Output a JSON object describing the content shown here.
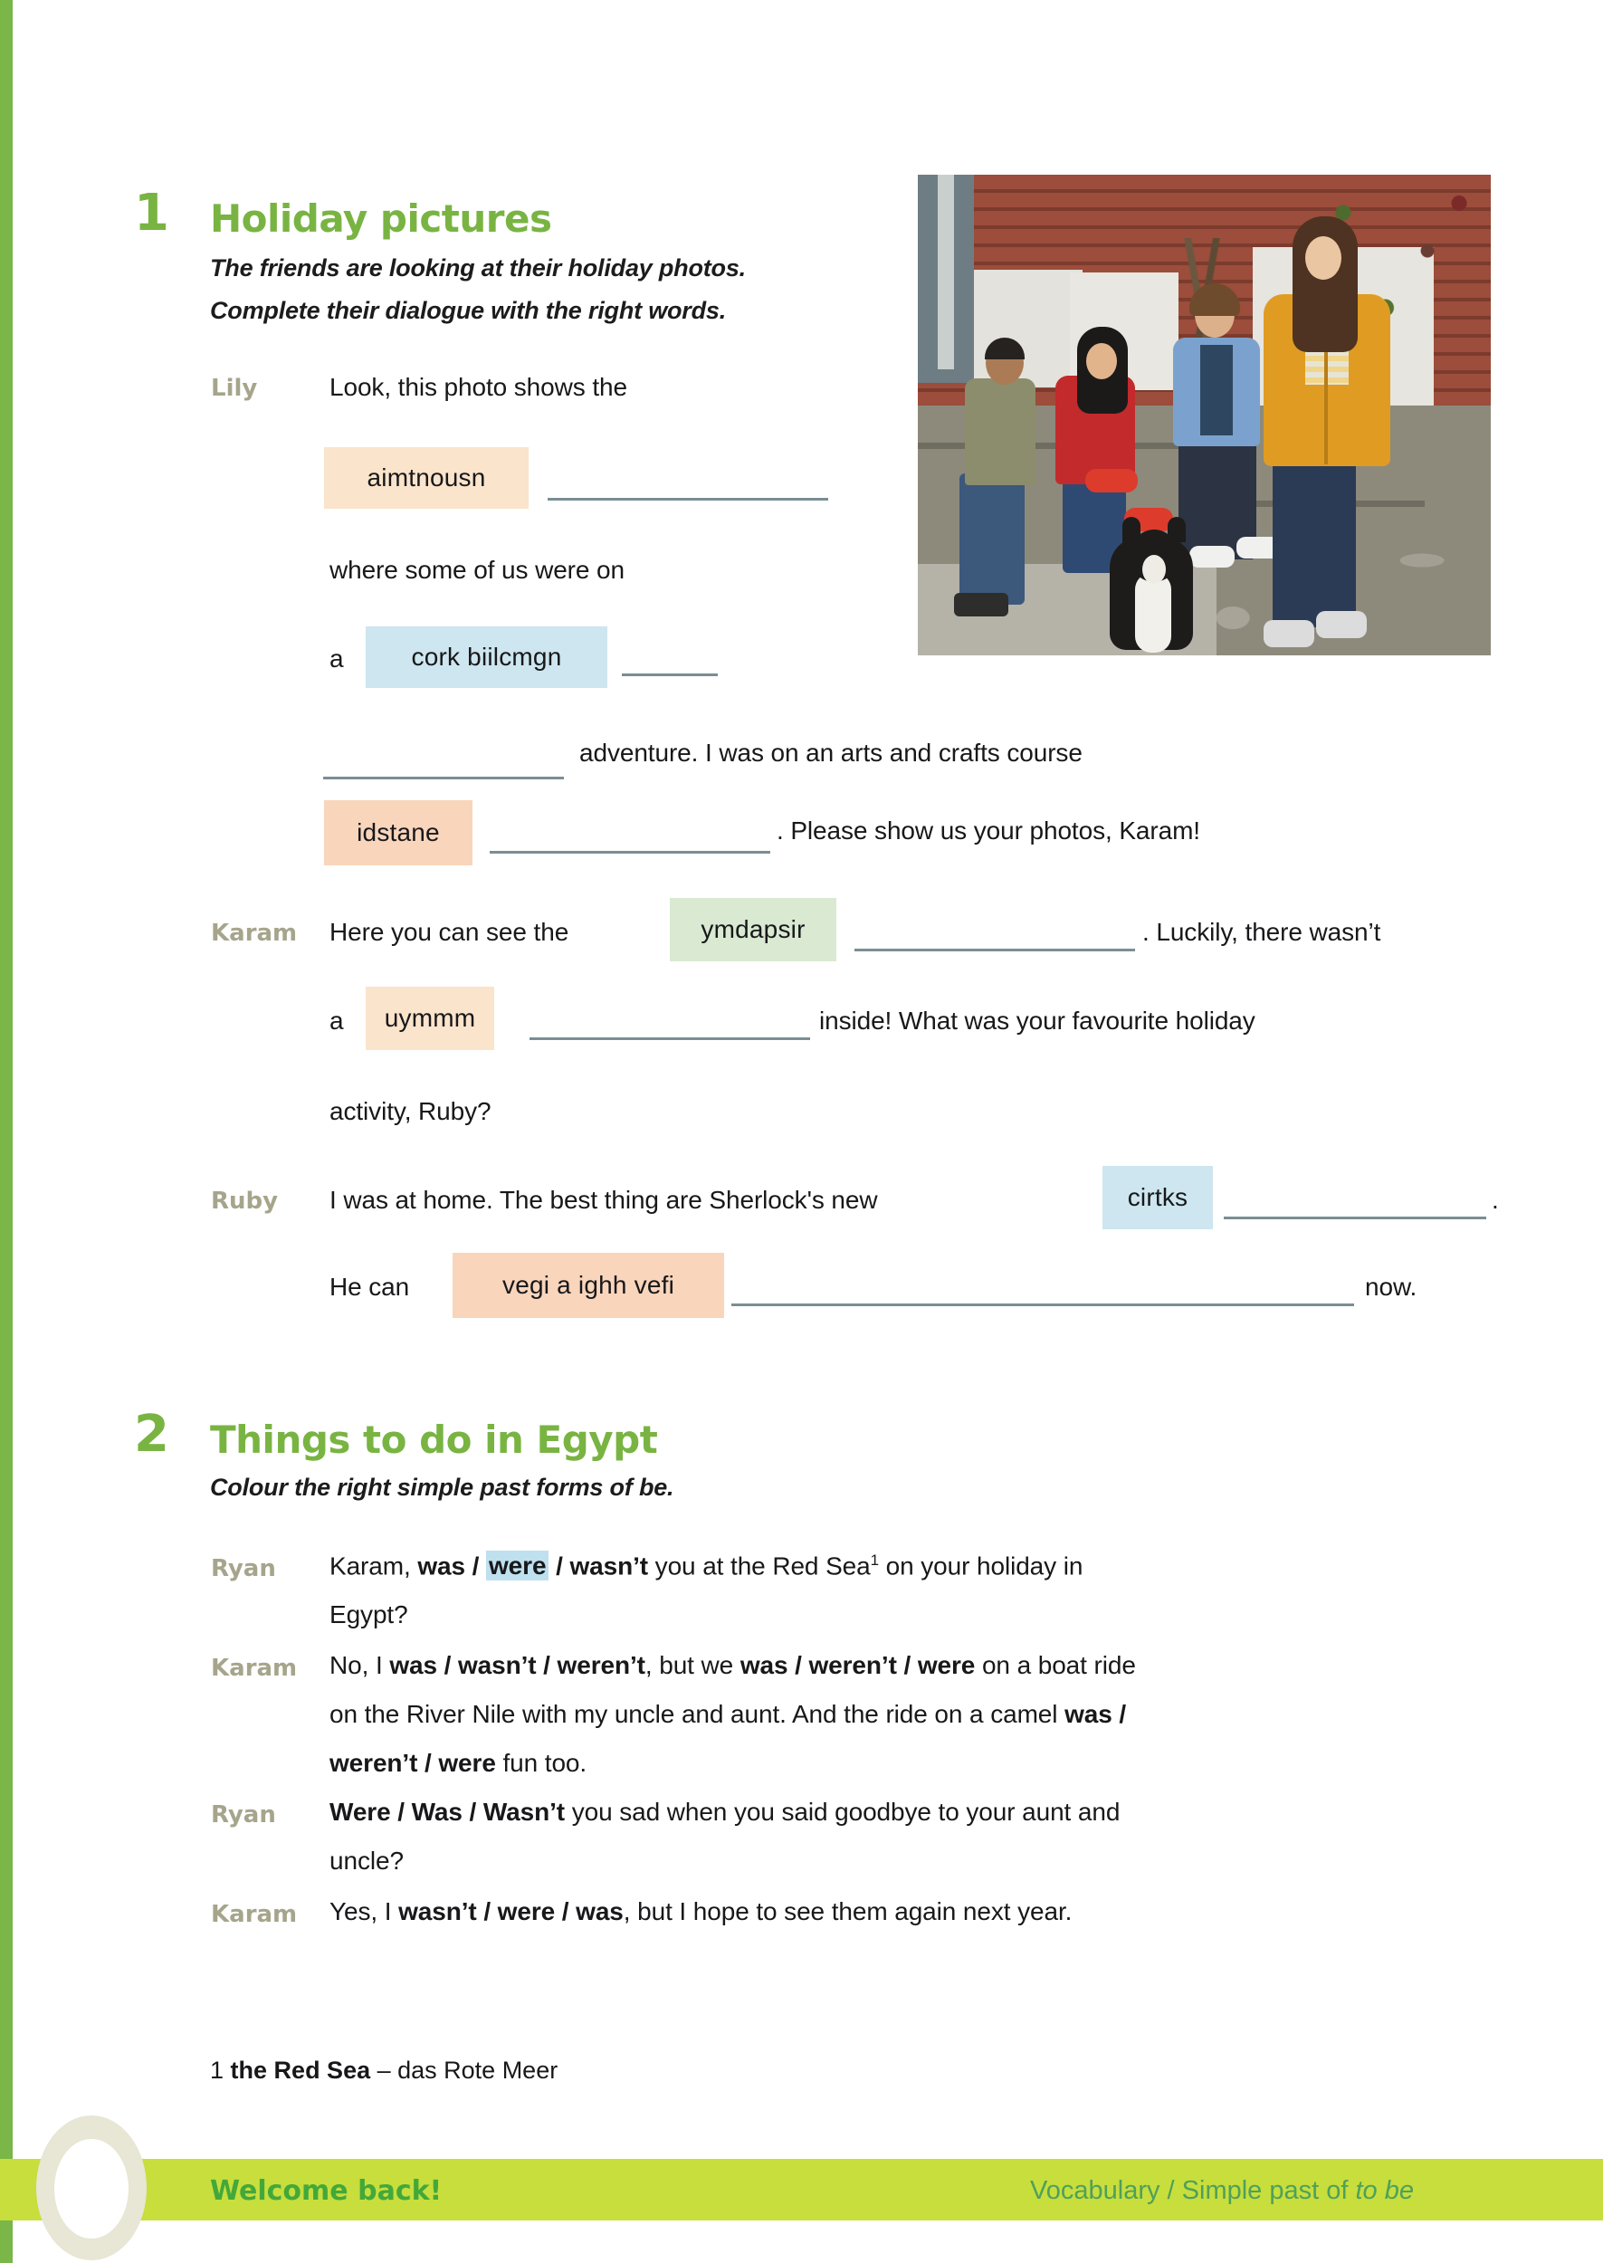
{
  "exercise1": {
    "number": "1",
    "title": "Holiday pictures",
    "instruction_line1": "The friends are looking at their holiday photos.",
    "instruction_line2": "Complete their dialogue with the right words.",
    "speakers": {
      "lily": "Lily",
      "karam": "Karam",
      "ruby": "Ruby"
    },
    "lily_t1": "Look, this photo shows the",
    "lily_chip1": "aimtnousn",
    "lily_t2": "where some of us were on",
    "lily_a": "a",
    "lily_chip2": "cork biilcmgn",
    "lily_t3": "adventure. I was on an arts and crafts course",
    "lily_chip3": "idstane",
    "lily_t4": ". Please show us your photos, Karam!",
    "karam_t1": "Here you can see the",
    "karam_chip1": "ymdapsir",
    "karam_t2": ". Luckily, there wasn’t",
    "karam_a": "a",
    "karam_chip2": "uymmm",
    "karam_t3": "inside!  What was your favourite holiday",
    "karam_t4": "activity, Ruby?",
    "ruby_t1": "I was at home. The best thing are Sherlock's new",
    "ruby_chip1": "cirtks",
    "ruby_t2": ".",
    "ruby_t3": "He can",
    "ruby_chip2": "vegi a ighh vefi",
    "ruby_t4": "now."
  },
  "exercise2": {
    "number": "2",
    "title": "Things to do in Egypt",
    "instruction_pre": "Colour the right simple past forms of ",
    "instruction_bold": "be",
    "instruction_post": ".",
    "lines": [
      {
        "speaker": "Ryan",
        "row1_pre": "Karam, ",
        "opt_a": "was",
        "opt_b": "were",
        "opt_c": "wasn’t",
        "row1_post": " you at the Red Sea",
        "sup": "1",
        "row1_tail": " on your holiday in",
        "row2": "Egypt?"
      },
      {
        "speaker": "Karam",
        "row2": "weren’t / were fun too."
      },
      {
        "speaker": "Ryan",
        "row2": "uncle?"
      },
      {
        "speaker": "Karam",
        "row2": ""
      }
    ],
    "karam1_p1": "No, I ",
    "karam1_b1": "was / wasn’t / weren’t",
    "karam1_p2": ", but we ",
    "karam1_b2": "was / weren’t / were",
    "karam1_p3": " on a boat ride",
    "karam1_r2_p1": "on the River Nile with my uncle and aunt. And the ride on a camel ",
    "karam1_r2_b1": "was /",
    "karam1_r3_b1": "weren’t / were",
    "karam1_r3_p1": " fun too.",
    "ryan2_b1": "Were / Was / Wasn’t",
    "ryan2_p1": " you sad when you said goodbye to your aunt and",
    "ryan2_r2": "uncle?",
    "karam2_p1": "Yes, I ",
    "karam2_b1": "wasn’t / were / was",
    "karam2_p2": ", but I hope to see them again next year."
  },
  "footnote": {
    "marker": "1",
    "term": "the Red Sea",
    "definition": " – das Rote Meer"
  },
  "footer": {
    "left": "Welcome back!",
    "right_pre": "Vocabulary / Simple past of ",
    "right_italic": "to be"
  },
  "photo": {
    "alt": "four-teenagers-on-stone-steps-with-border-collie-dog"
  },
  "colors": {
    "green": "#79b443",
    "lime_bar": "#c7de3c",
    "highlight_peach": "#fae4cb",
    "highlight_peach_deep": "#f9d5bc",
    "highlight_blue": "#cde6ef",
    "highlight_green": "#d9e9d2",
    "rule": "#7a8e94",
    "speaker": "#a6a58c"
  }
}
